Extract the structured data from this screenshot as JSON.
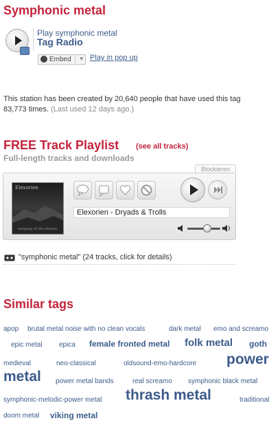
{
  "header": {
    "title": "Symphonic metal"
  },
  "radio": {
    "subtitle": "Play symphonic metal",
    "title": "Tag Radio",
    "embed_label": "Embed",
    "popup_link": "Play in pop up"
  },
  "stats": {
    "line1": "This station has been created by 20,640 people that have used this tag",
    "line2_main": "83,773 times.",
    "line2_muted": "(Last used 12 days ago.)"
  },
  "playlist": {
    "title": "FREE Track Playlist",
    "see_all": "(see all tracks)",
    "subtitle": "Full-length tracks and downloads",
    "block_label": "Blockieren",
    "track_name": "Elexorien - Dryads & Trolls",
    "album_art_caption": "Elexorien",
    "album_art_subcaption": "weeping of the ofasses",
    "volume_level": 0.6,
    "summary": "\"symphonic metal\" (24 tracks, click for details)"
  },
  "similar": {
    "title": "Similar tags",
    "tags": [
      {
        "label": "apop",
        "size": "s"
      },
      {
        "label": "brutal metal noise with no clean vocals",
        "size": "s"
      },
      {
        "label": "dark metal",
        "size": "s"
      },
      {
        "label": "emo and screamo",
        "size": "s"
      },
      {
        "label": "epic metal",
        "size": "s"
      },
      {
        "label": "epica",
        "size": "s"
      },
      {
        "label": "female fronted metal",
        "size": "m"
      },
      {
        "label": "folk metal",
        "size": "l"
      },
      {
        "label": "goth",
        "size": "m"
      },
      {
        "label": "medieval",
        "size": "s"
      },
      {
        "label": "neo-classical",
        "size": "s"
      },
      {
        "label": "oldsound-emo-hardcore",
        "size": "s"
      },
      {
        "label": "power",
        "size": "xl"
      },
      {
        "label": "metal",
        "size": "xl"
      },
      {
        "label": "power metal bands",
        "size": "s"
      },
      {
        "label": "real screamo",
        "size": "s"
      },
      {
        "label": "symphonic black metal",
        "size": "s"
      },
      {
        "label": "symphonic-melodic-power metal",
        "size": "s"
      },
      {
        "label": "thrash metal",
        "size": "xl"
      },
      {
        "label": "traditional",
        "size": "s"
      },
      {
        "label": "doom metal",
        "size": "s"
      },
      {
        "label": "viking metal",
        "size": "m"
      }
    ]
  },
  "colors": {
    "accent": "#c3243c",
    "link": "#3c5b8a"
  }
}
